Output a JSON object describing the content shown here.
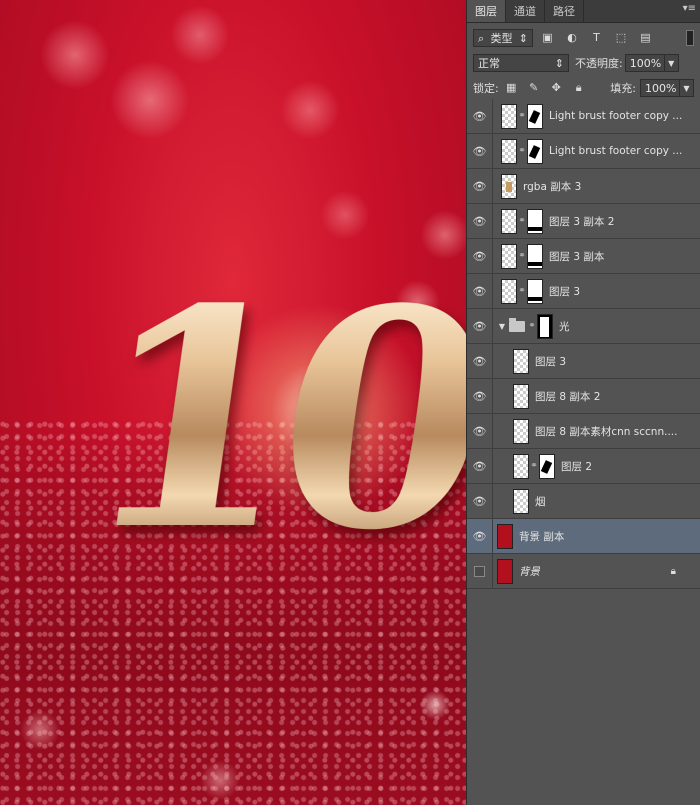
{
  "canvas": {
    "hero_text": "10",
    "accent_color": "#c8102a",
    "gold_color": "#e9c59a"
  },
  "panel": {
    "tabs": [
      {
        "label": "图层",
        "active": true
      },
      {
        "label": "通道",
        "active": false
      },
      {
        "label": "路径",
        "active": false
      }
    ],
    "filter_kind": "类型",
    "blend_mode": "正常",
    "opacity_label": "不透明度:",
    "opacity_value": "100%",
    "lock_label": "锁定:",
    "fill_label": "填充:",
    "fill_value": "100%"
  },
  "layers": [
    {
      "name": "Light brust footer copy ...",
      "visible": true,
      "thumb": "checker",
      "mask": "brush"
    },
    {
      "name": "Light brust footer copy ...",
      "visible": true,
      "thumb": "checker",
      "mask": "brush"
    },
    {
      "name": "rgba 副本 3",
      "visible": true,
      "thumb": "gold",
      "mask": ""
    },
    {
      "name": "图层 3 副本 2",
      "visible": true,
      "thumb": "checker",
      "mask": "bar"
    },
    {
      "name": "图层 3 副本",
      "visible": true,
      "thumb": "checker",
      "mask": "bar"
    },
    {
      "name": "图层 3",
      "visible": true,
      "thumb": "checker",
      "mask": "bar"
    },
    {
      "name": "光",
      "visible": true,
      "group": true,
      "mask": "black"
    },
    {
      "name": "图层 3",
      "visible": true,
      "thumb": "checker",
      "indent": true
    },
    {
      "name": "图层 8 副本 2",
      "visible": true,
      "thumb": "checker",
      "indent": true
    },
    {
      "name": "图层 8 副本素材cnn sccnn....",
      "visible": true,
      "thumb": "checker",
      "indent": true
    },
    {
      "name": "图层 2",
      "visible": true,
      "thumb": "checker",
      "mask": "brush",
      "indent": true
    },
    {
      "name": "烟",
      "visible": true,
      "thumb": "checker",
      "indent": true
    },
    {
      "name": "背景 副本",
      "visible": true,
      "thumb": "red",
      "selected": true
    },
    {
      "name": "背景",
      "visible": false,
      "thumb": "red",
      "locked": true,
      "italic": true
    }
  ]
}
